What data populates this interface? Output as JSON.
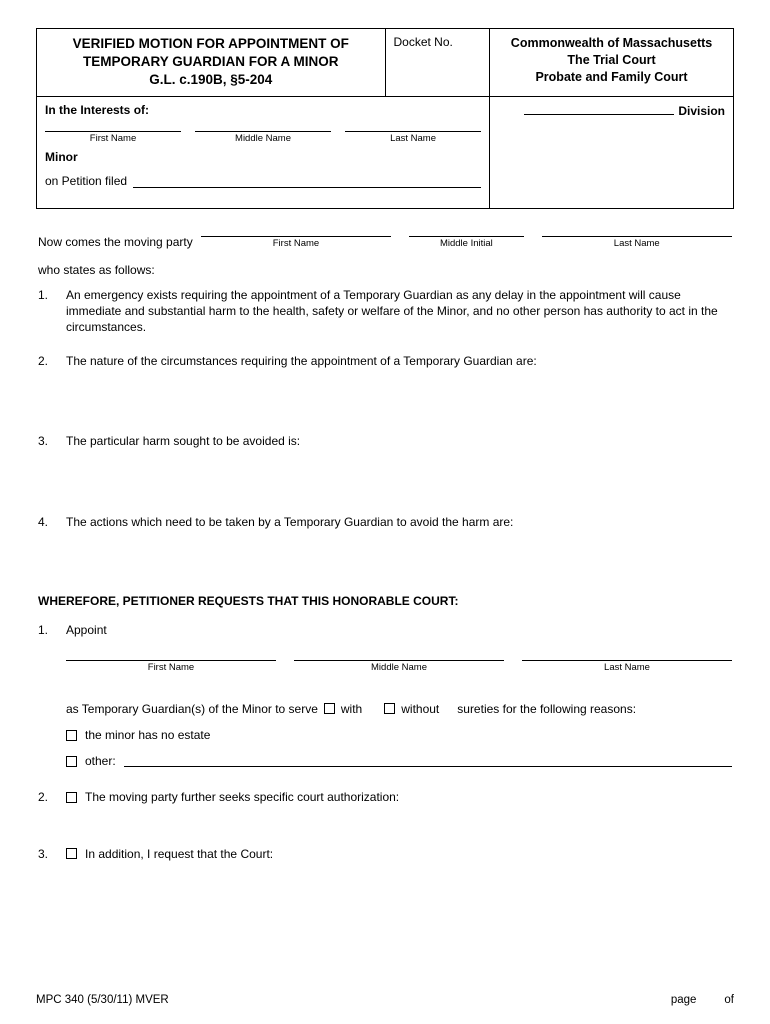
{
  "header": {
    "title_line1": "VERIFIED MOTION FOR APPOINTMENT OF",
    "title_line2": "TEMPORARY GUARDIAN FOR A MINOR",
    "title_line3": "G.L. c.190B, §5-204",
    "docket_label": "Docket No.",
    "court_line1": "Commonwealth of Massachusetts",
    "court_line2": "The Trial Court",
    "court_line3": "Probate and Family Court"
  },
  "interest": {
    "label": "In the Interests of:",
    "first": "First Name",
    "middle": "Middle Name",
    "last": "Last Name",
    "minor": "Minor",
    "petition": "on Petition filed",
    "division": "Division"
  },
  "moving": {
    "intro": "Now comes the moving party",
    "first": "First Name",
    "middle": "Middle Initial",
    "last": "Last Name",
    "follows": "who states as follows:"
  },
  "statements": {
    "s1": "An emergency exists requiring the appointment of a Temporary Guardian as any delay in the appointment will cause immediate and substantial harm to the health, safety or welfare of the Minor, and no other person has authority to act in the circumstances.",
    "s2": "The nature of the circumstances requiring the appointment of a Temporary Guardian are:",
    "s3": "The particular harm sought to be avoided is:",
    "s4": "The actions which need to be taken by a Temporary Guardian to avoid the harm are:"
  },
  "wherefore": "WHEREFORE, PETITIONER REQUESTS THAT THIS HONORABLE COURT:",
  "requests": {
    "r1_label": "Appoint",
    "first": "First Name",
    "middle": "Middle Name",
    "last": "Last Name",
    "serve_prefix": "as Temporary Guardian(s) of the Minor to serve",
    "with": "with",
    "without": "without",
    "serve_suffix": "sureties for the following reasons:",
    "reason_noestate": "the minor has no estate",
    "reason_other": "other:",
    "r2": "The moving party further seeks specific court authorization:",
    "r3": "In addition, I request that the Court:"
  },
  "footer": {
    "form": "MPC 340  (5/30/11)   MVER",
    "page": "page",
    "of": "of"
  },
  "nums": {
    "n1": "1.",
    "n2": "2.",
    "n3": "3.",
    "n4": "4."
  }
}
